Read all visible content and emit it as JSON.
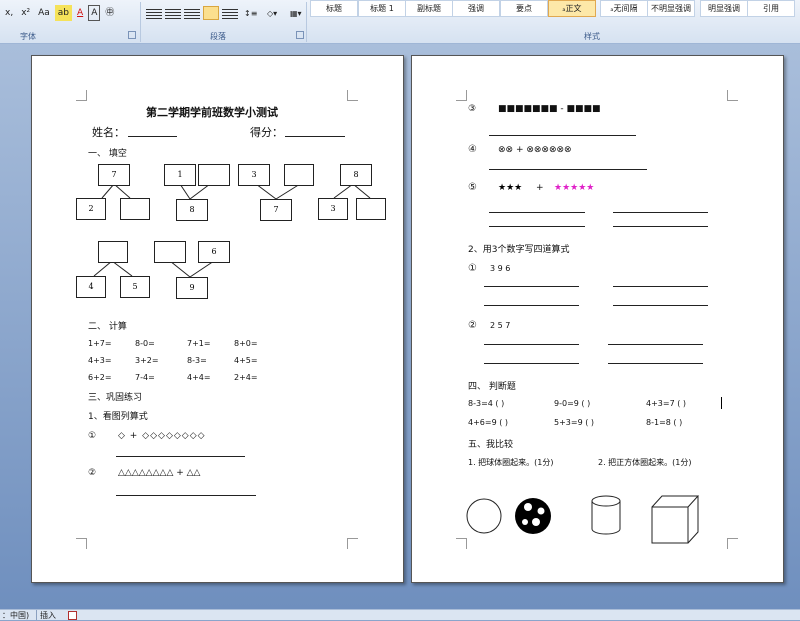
{
  "ribbon": {
    "font_group_label": "字体",
    "paragraph_group_label": "段落",
    "styles_group_label": "样式",
    "font_buttons": [
      "x,",
      "x²",
      "Aa",
      "ab",
      "A",
      "A",
      "㊥"
    ],
    "styles": [
      "标题",
      "标题 1",
      "副标题",
      "强调",
      "要点",
      "ₐ正文",
      "ₐ无间隔",
      "不明显强调",
      "明显强调",
      "引用"
    ],
    "active_style": "ₐ正文"
  },
  "page1": {
    "title": "第二学期学前班数学小测试",
    "name_label": "姓名：",
    "score_label": "得分：",
    "section1": "一、 填空",
    "boxes_row1": [
      "7",
      "",
      "",
      "1",
      "",
      "",
      "",
      "8",
      "3",
      "",
      "",
      "7",
      "8",
      "",
      "3",
      ""
    ],
    "boxes_row2": [
      "",
      "",
      "4",
      "5",
      "",
      "6",
      "9"
    ],
    "section2": "二、 计算",
    "calc": [
      [
        "1+7=",
        "8-0=",
        "7+1=",
        "8+0="
      ],
      [
        "4+3=",
        "3+2=",
        "8-3=",
        "4+5="
      ],
      [
        "6+2=",
        "7-4=",
        "4+4=",
        "2+4="
      ]
    ],
    "section3": "三、巩固练习",
    "sub1": "1、看图列算式",
    "q1_num": "①",
    "q1_content": "◇  +  ◇◇◇◇◇◇◇◇",
    "q2_num": "②",
    "q2_content": "△△△△△△△△    +   △△"
  },
  "page2": {
    "q3_num": "③",
    "q3_content": "■■■■■■■  -  ■■■■",
    "q4_num": "④",
    "q4_content": "⊗⊗   +   ⊗⊗⊗⊗⊗⊗",
    "q5_num": "⑤",
    "q5_stars_a": "★★★",
    "q5_plus": "+",
    "q5_stars_b": "★★★★★",
    "sub2": "2、用3个数字写四道算式",
    "r1_num": "①",
    "r1_digits": "3     9     6",
    "r2_num": "②",
    "r2_digits": "2     5     7",
    "section4": "四、 判断题",
    "judge": [
      [
        "8-3=4   (     )",
        "9-0=9   (     )",
        "4+3=7   (     )"
      ],
      [
        "4+6=9   (     )",
        "5+3=9   (     )",
        "8-1=8   (     )"
      ]
    ],
    "section5": "五、我比较",
    "compare1": "1. 把球体圈起来。(1分)",
    "compare2": "2. 把正方体圈起来。(1分)",
    "star_color_a": "#000000",
    "star_color_b": "#e020c8"
  },
  "statusbar": {
    "language": "：中国)",
    "mode": "插入"
  }
}
